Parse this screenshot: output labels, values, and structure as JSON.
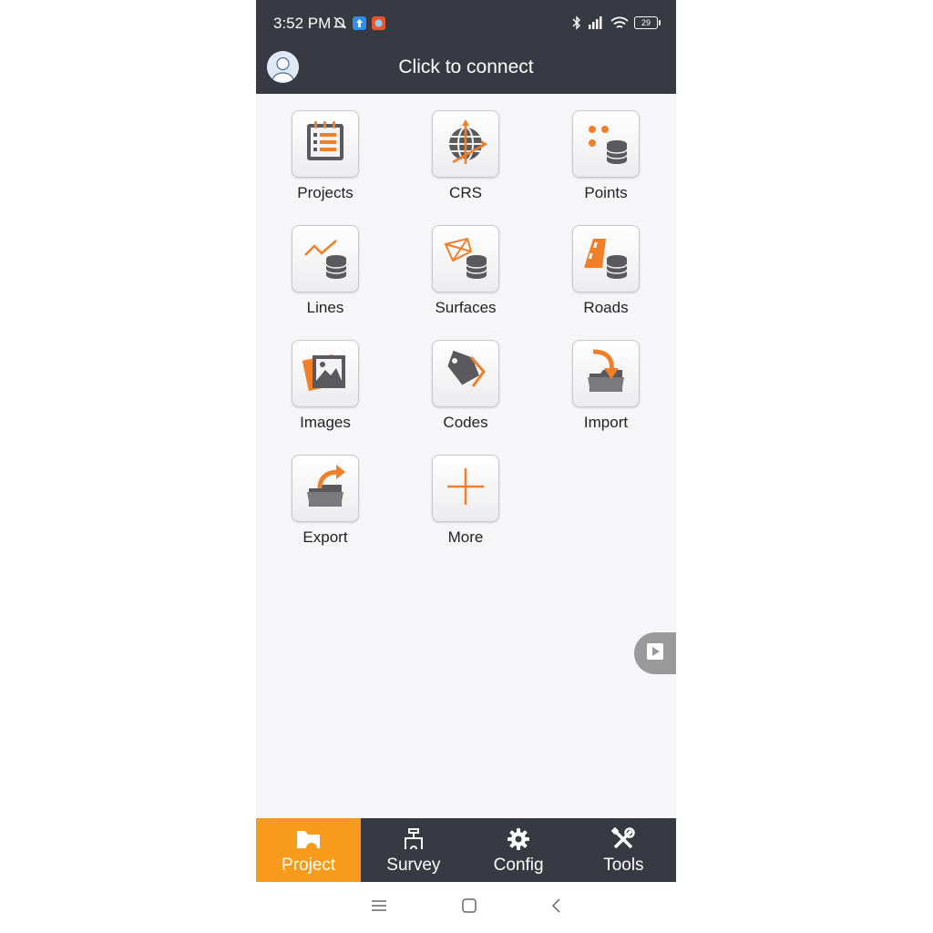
{
  "status_bar": {
    "time": "3:52 PM",
    "battery": "29"
  },
  "header": {
    "title": "Click to connect",
    "avatar_icon": "user-avatar-icon"
  },
  "tiles": [
    {
      "label": "Projects",
      "icon": "projects-icon"
    },
    {
      "label": "CRS",
      "icon": "crs-globe-icon"
    },
    {
      "label": "Points",
      "icon": "points-database-icon"
    },
    {
      "label": "Lines",
      "icon": "lines-database-icon"
    },
    {
      "label": "Surfaces",
      "icon": "surfaces-database-icon"
    },
    {
      "label": "Roads",
      "icon": "roads-database-icon"
    },
    {
      "label": "Images",
      "icon": "images-icon"
    },
    {
      "label": "Codes",
      "icon": "codes-tag-icon"
    },
    {
      "label": "Import",
      "icon": "import-folder-icon"
    },
    {
      "label": "Export",
      "icon": "export-folder-icon"
    },
    {
      "label": "More",
      "icon": "plus-icon"
    }
  ],
  "bottom_nav": [
    {
      "label": "Project",
      "active": true
    },
    {
      "label": "Survey",
      "active": false
    },
    {
      "label": "Config",
      "active": false
    },
    {
      "label": "Tools",
      "active": false
    }
  ],
  "colors": {
    "accent": "#f89a1b",
    "bar": "#373a42",
    "icon_gray": "#5a5a5e",
    "icon_orange": "#f07f2a"
  }
}
